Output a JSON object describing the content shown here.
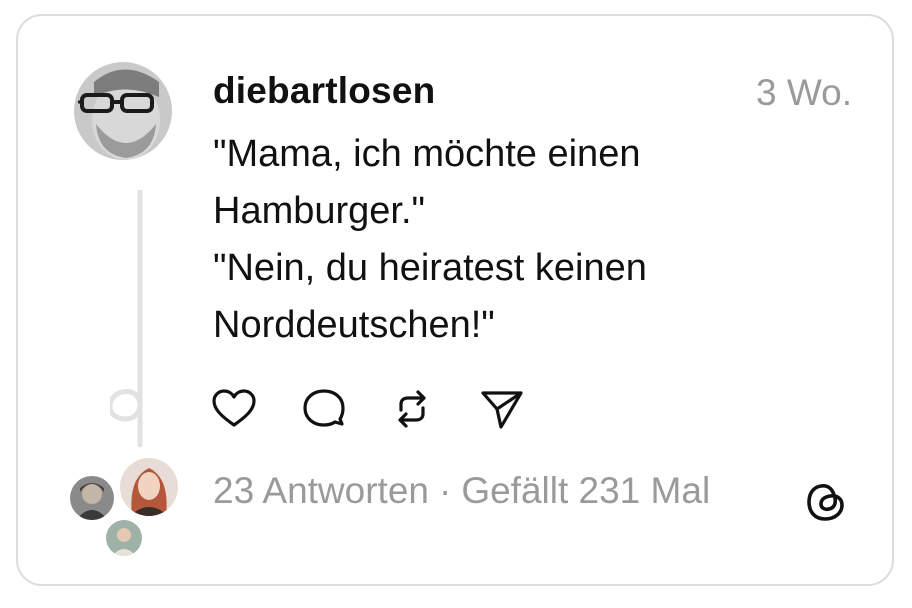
{
  "post": {
    "username": "diebartlosen",
    "timestamp": "3 Wo.",
    "text_lines": [
      "\"Mama, ich möchte einen",
      "Hamburger.\"",
      "\"Nein, du heiratest keinen",
      "Norddeutschen!\""
    ],
    "replies": "23 Antworten",
    "separator": "·",
    "likes": "Gefällt 231 Mal"
  },
  "icons": {
    "like": "heart-icon",
    "reply": "comment-icon",
    "repost": "repost-icon",
    "share": "send-icon",
    "brand": "threads-logo"
  },
  "colors": {
    "text": "#111111",
    "muted": "#9a9a9a",
    "border": "#dcdcdc",
    "thread_line": "#e2e2e2"
  }
}
